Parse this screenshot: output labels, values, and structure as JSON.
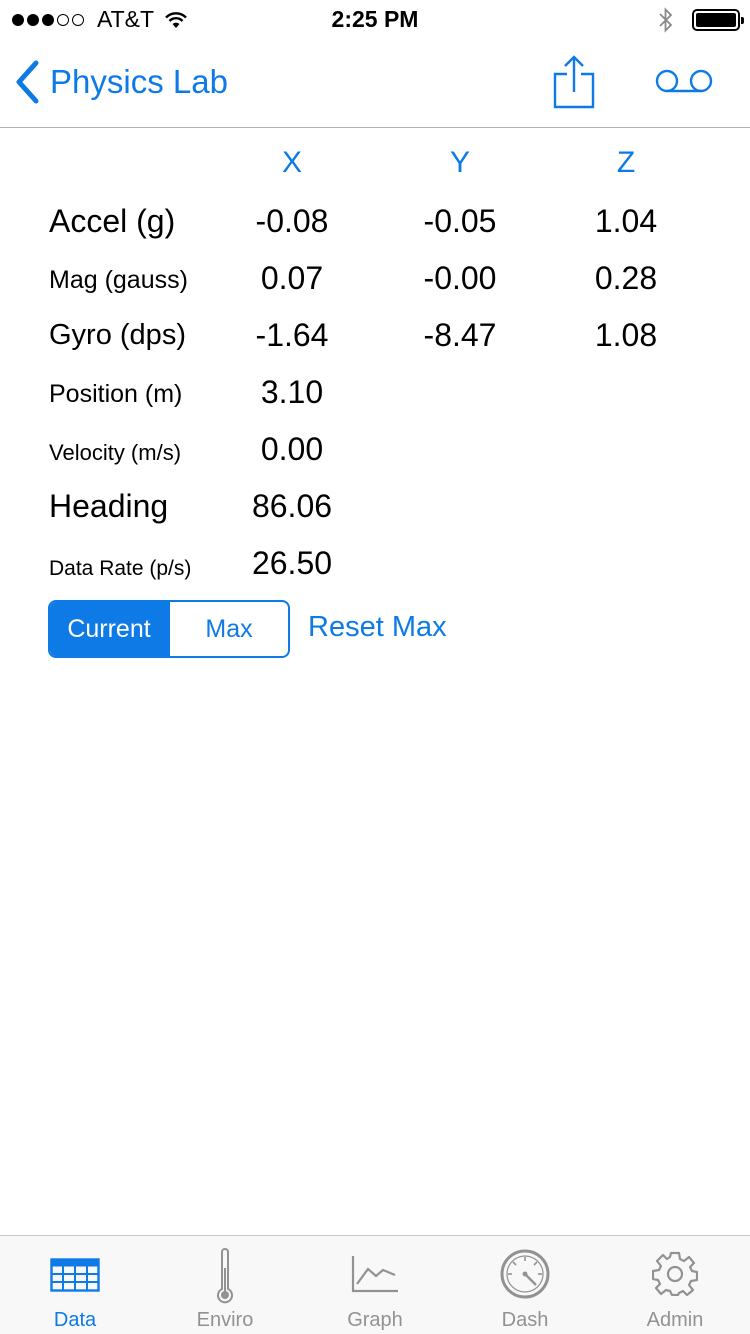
{
  "status_bar": {
    "carrier": "AT&T",
    "time": "2:25 PM",
    "signal_dots_filled": 3,
    "signal_dots_total": 5
  },
  "nav": {
    "back_label": "Physics Lab",
    "share_icon": "share-icon",
    "record_icon": "voicemail-icon"
  },
  "table": {
    "headers": [
      "X",
      "Y",
      "Z"
    ],
    "rows": [
      {
        "label": "Accel (g)",
        "x": "-0.08",
        "y": "-0.05",
        "z": "1.04"
      },
      {
        "label": "Mag (gauss)",
        "x": "0.07",
        "y": "-0.00",
        "z": "0.28"
      },
      {
        "label": "Gyro (dps)",
        "x": "-1.64",
        "y": "-8.47",
        "z": "1.08"
      },
      {
        "label": "Position (m)",
        "x": "3.10"
      },
      {
        "label": "Velocity (m/s)",
        "x": "0.00"
      },
      {
        "label": "Heading",
        "x": "86.06"
      },
      {
        "label": "Data Rate (p/s)",
        "x": "26.50"
      }
    ]
  },
  "segmented": {
    "options": [
      "Current",
      "Max"
    ],
    "selected": "Current"
  },
  "reset_max_label": "Reset Max",
  "tabs": [
    {
      "label": "Data",
      "icon": "table-icon",
      "active": true
    },
    {
      "label": "Enviro",
      "icon": "thermometer-icon",
      "active": false
    },
    {
      "label": "Graph",
      "icon": "line-chart-icon",
      "active": false
    },
    {
      "label": "Dash",
      "icon": "gauge-icon",
      "active": false
    },
    {
      "label": "Admin",
      "icon": "gear-icon",
      "active": false
    }
  ],
  "colors": {
    "accent": "#0e7ae6",
    "inactive_tab": "#929292"
  }
}
